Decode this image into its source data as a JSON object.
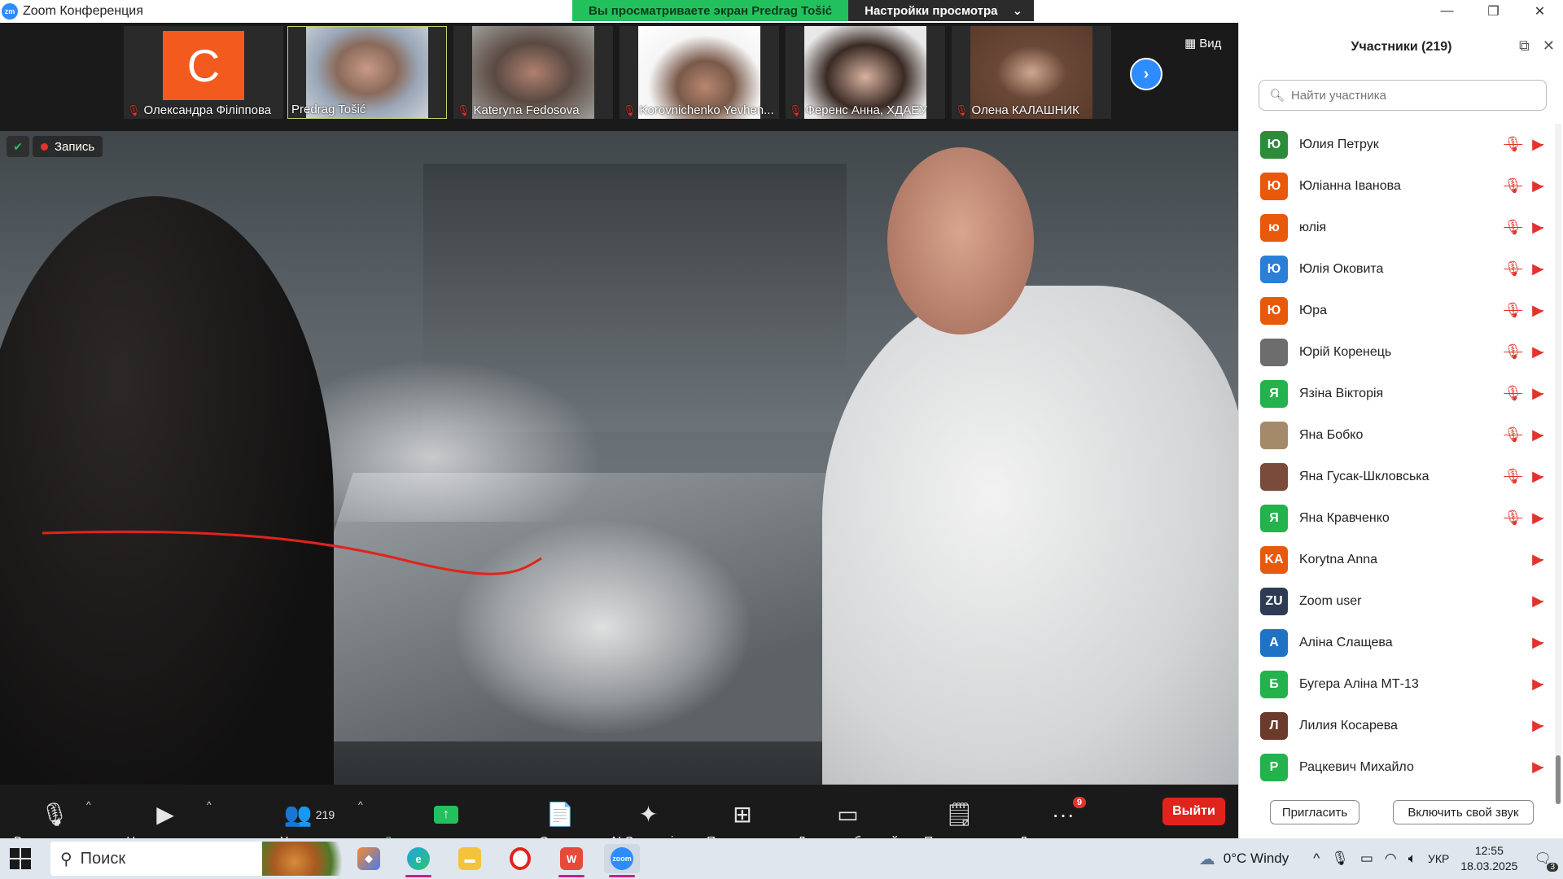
{
  "window": {
    "title": "Zoom Конференция",
    "app_icon": "zm"
  },
  "share_banner": {
    "viewing": "Вы просматриваете экран Predrag Tošić",
    "view_settings": "Настройки просмотра"
  },
  "thumbnails": [
    {
      "name": "Олександра Філіппова",
      "avatar_letter": "C",
      "muted": true
    },
    {
      "name": "Predrag Tošić",
      "muted": false,
      "active": true
    },
    {
      "name": "Kateryna Fedosova",
      "muted": true
    },
    {
      "name": "Korovnichenko Yevhen...",
      "muted": true
    },
    {
      "name": "Ференс Анна, ХДАЕУ",
      "muted": true
    },
    {
      "name": "Олена КАЛАШНИК",
      "muted": true
    }
  ],
  "view_button": "Вид",
  "recording": {
    "label": "Запись"
  },
  "toolbar": {
    "audio": "Включить звук",
    "video": "Начать видео",
    "participants": "Участники",
    "participants_count": "219",
    "share": "Демонстрация экрана",
    "summary": "Сводка",
    "ai": "AI Companion",
    "apps": "Приложения",
    "boards": "Доски сообщений",
    "notes": "Примечания",
    "more": "Дополнительно",
    "more_badge": "9",
    "leave": "Выйти"
  },
  "panel": {
    "title": "Участники (219)",
    "search_placeholder": "Найти участника",
    "participants": [
      {
        "name": "Юлия Петрук",
        "initial": "Ю",
        "color": "#2e8b3a",
        "mic_muted": true
      },
      {
        "name": "Юліанна Іванова",
        "initial": "Ю",
        "color": "#e8590c",
        "mic_muted": true
      },
      {
        "name": "юлія",
        "initial": "ю",
        "color": "#e8590c",
        "mic_muted": true
      },
      {
        "name": "Юлія Оковита",
        "initial": "Ю",
        "color": "#2b7fd6",
        "mic_muted": true
      },
      {
        "name": "Юра",
        "initial": "Ю",
        "color": "#e8590c",
        "mic_muted": true
      },
      {
        "name": "Юрій Коренець",
        "initial": "",
        "color": "#6d6d6d",
        "mic_muted": true
      },
      {
        "name": "Язіна Вікторія",
        "initial": "Я",
        "color": "#23b24c",
        "mic_muted": true
      },
      {
        "name": "Яна Бобко",
        "initial": "",
        "color": "#a58a6a",
        "mic_muted": true
      },
      {
        "name": "Яна Гусак-Шкловська",
        "initial": "",
        "color": "#7a4a3a",
        "mic_muted": true
      },
      {
        "name": "Яна Кравченко",
        "initial": "Я",
        "color": "#23b24c",
        "mic_muted": true
      },
      {
        "name": "Korytna Anna",
        "initial": "KA",
        "color": "#e8590c",
        "mic_muted": false
      },
      {
        "name": "Zoom user",
        "initial": "ZU",
        "color": "#2d3b55",
        "mic_muted": false
      },
      {
        "name": "Аліна Слащева",
        "initial": "А",
        "color": "#1f73c4",
        "mic_muted": false
      },
      {
        "name": "Бугера Аліна МТ-13",
        "initial": "Б",
        "color": "#23b24c",
        "mic_muted": false
      },
      {
        "name": "Лилия Косарева",
        "initial": "Л",
        "color": "#6b3a2a",
        "mic_muted": false
      },
      {
        "name": "Рацкевич Михайло",
        "initial": "Р",
        "color": "#23b24c",
        "mic_muted": false
      }
    ],
    "invite": "Пригласить",
    "unmute_self": "Включить свой звук"
  },
  "taskbar": {
    "search": "Поиск",
    "weather": "0°C  Windy",
    "lang": "УКР",
    "time": "12:55",
    "date": "18.03.2025",
    "notif_count": "3"
  }
}
